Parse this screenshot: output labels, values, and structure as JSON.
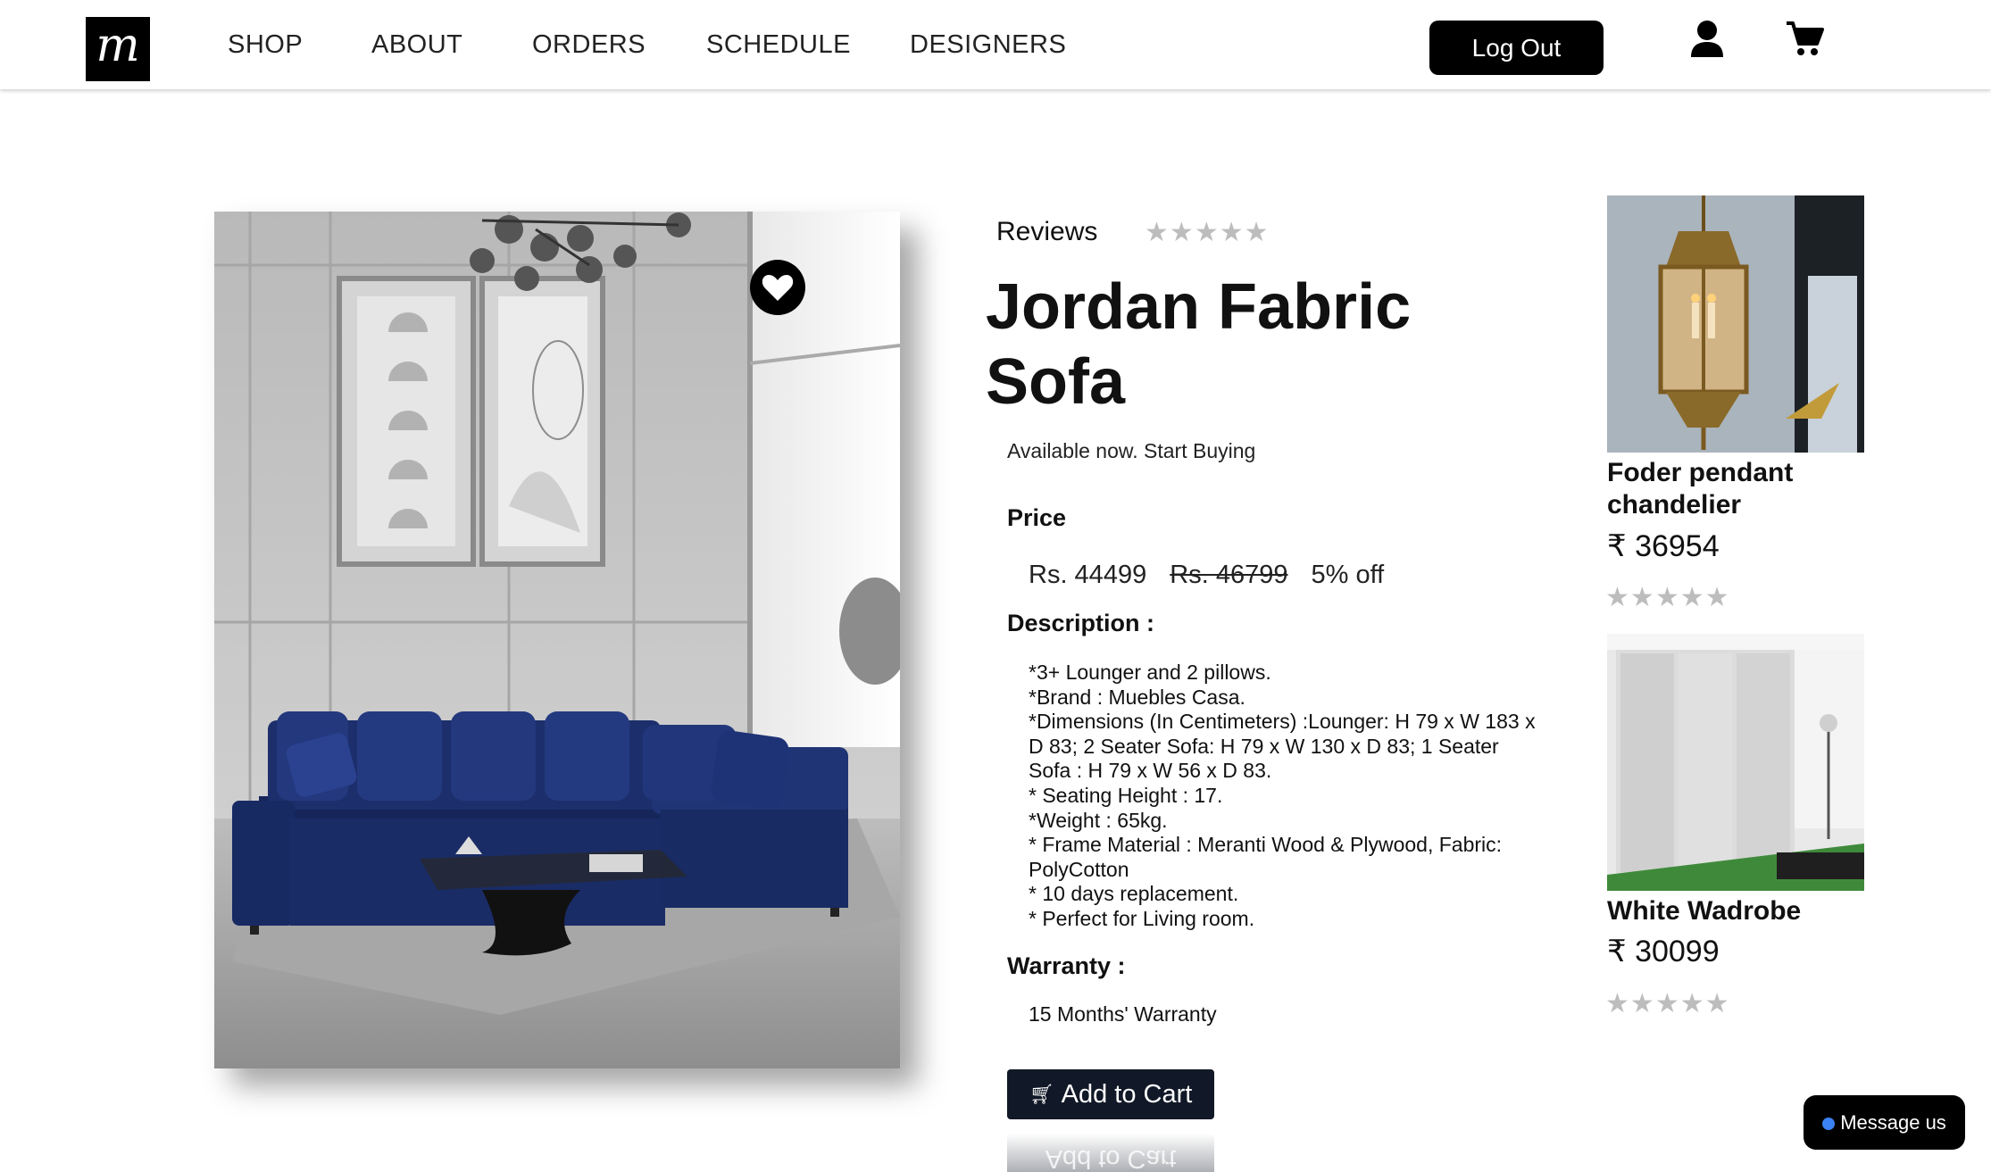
{
  "brand": {
    "logo_text": "m"
  },
  "nav": {
    "items": [
      {
        "label": "SHOP"
      },
      {
        "label": "ABOUT"
      },
      {
        "label": "ORDERS"
      },
      {
        "label": "SCHEDULE"
      },
      {
        "label": "DESIGNERS"
      }
    ],
    "logout_label": "Log Out",
    "icons": [
      "user-icon",
      "cart-icon"
    ]
  },
  "product": {
    "reviews_label": "Reviews",
    "rating": 0,
    "title": "Jordan Fabric Sofa",
    "availability": "Available now. Start Buying",
    "price_heading": "Price",
    "price": "Rs. 44499",
    "original_price": "Rs. 46799",
    "discount": "5% off",
    "description_heading": "Description :",
    "description": [
      "*3+ Lounger and 2 pillows.",
      "*Brand : Muebles Casa.",
      "*Dimensions (In Centimeters) :Lounger: H 79 x W 183 x D 83; 2 Seater Sofa: H 79 x W 130 x D 83; 1 Seater Sofa : H 79 x W 56 x D 83.",
      "* Seating Height : 17.",
      "*Weight : 65kg.",
      "* Frame Material : Meranti Wood & Plywood, Fabric: PolyCotton",
      "* 10 days replacement.",
      "* Perfect for Living room."
    ],
    "warranty_heading": "Warranty :",
    "warranty": "15 Months' Warranty",
    "add_to_cart_label": "Add to Cart",
    "image_icon": "heart-icon"
  },
  "related": [
    {
      "name": "Foder pendant chandelier",
      "price": "₹ 36954",
      "rating": 0
    },
    {
      "name": "White Wadrobe",
      "price": "₹ 30099",
      "rating": 0
    }
  ],
  "chat": {
    "label": "Message us"
  },
  "colors": {
    "accent": "#000000",
    "button_dark": "#111827",
    "sofa_blue": "#1b2f6e",
    "star_inactive": "#bdbdbd",
    "chat_dot": "#3b82f6"
  }
}
